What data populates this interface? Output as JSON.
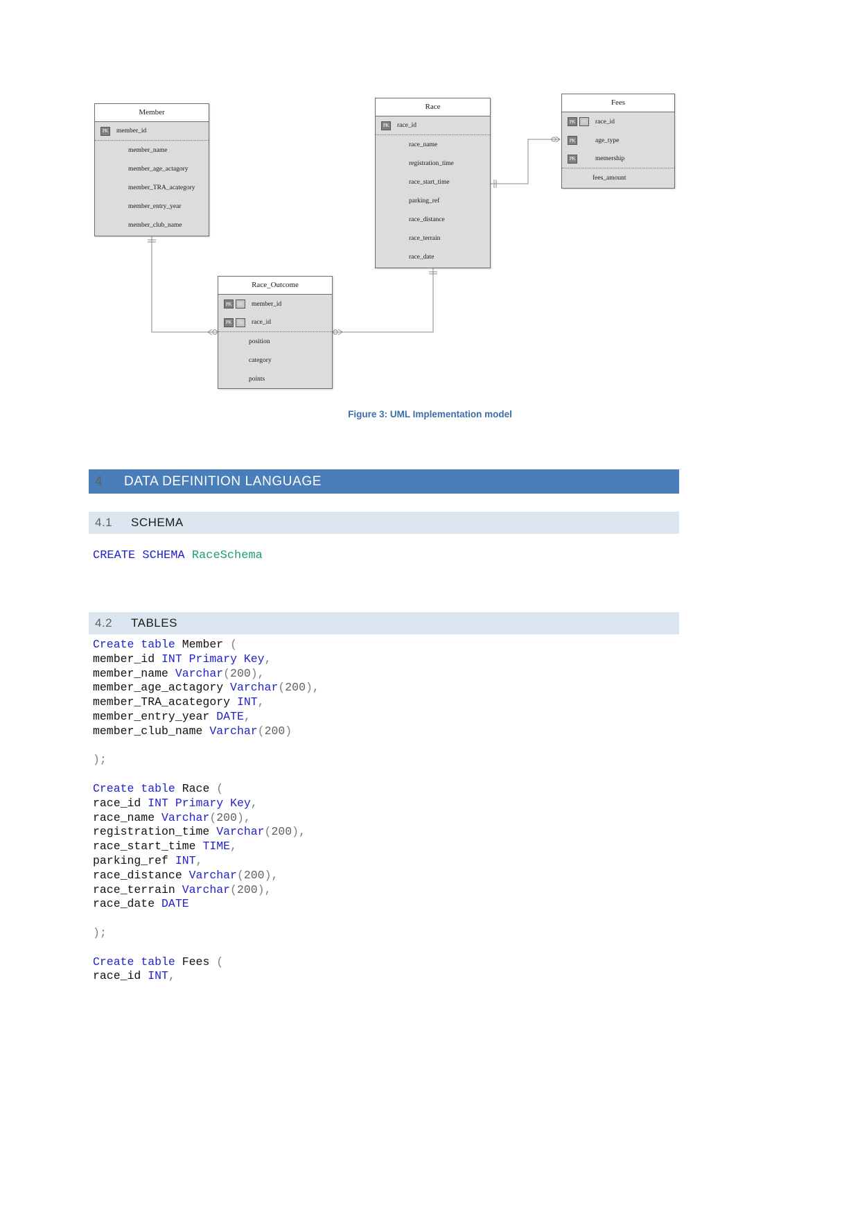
{
  "figure": {
    "caption": "Figure 3: UML Implementation model",
    "entities": [
      {
        "name": "Member",
        "attributes": [
          {
            "pk": "PK",
            "fk": "",
            "label": "member_id",
            "separator": true
          },
          {
            "pk": "",
            "fk": "",
            "label": "member_name",
            "separator": false
          },
          {
            "pk": "",
            "fk": "",
            "label": "member_age_actagory",
            "separator": false
          },
          {
            "pk": "",
            "fk": "",
            "label": "member_TRA_acategory",
            "separator": false
          },
          {
            "pk": "",
            "fk": "",
            "label": "member_entry_year",
            "separator": false
          },
          {
            "pk": "",
            "fk": "",
            "label": "member_club_name",
            "separator": false
          }
        ]
      },
      {
        "name": "Race",
        "attributes": [
          {
            "pk": "PK",
            "fk": "",
            "label": "race_id",
            "separator": true
          },
          {
            "pk": "",
            "fk": "",
            "label": "race_name",
            "separator": false
          },
          {
            "pk": "",
            "fk": "",
            "label": "registration_time",
            "separator": false
          },
          {
            "pk": "",
            "fk": "",
            "label": "race_start_time",
            "separator": false
          },
          {
            "pk": "",
            "fk": "",
            "label": "parking_ref",
            "separator": false
          },
          {
            "pk": "",
            "fk": "",
            "label": "race_distance",
            "separator": false
          },
          {
            "pk": "",
            "fk": "",
            "label": "race_terrain",
            "separator": false
          },
          {
            "pk": "",
            "fk": "",
            "label": "race_date",
            "separator": false
          }
        ]
      },
      {
        "name": "Fees",
        "attributes": [
          {
            "pk": "PK",
            "fk": "FK",
            "label": "race_id",
            "separator": false
          },
          {
            "pk": "PK",
            "fk": "",
            "label": "age_type",
            "separator": false
          },
          {
            "pk": "PK",
            "fk": "",
            "label": "memership",
            "separator": true
          },
          {
            "pk": "",
            "fk": "",
            "label": "fees_amount",
            "separator": false
          }
        ]
      },
      {
        "name": "Race_Outcome",
        "attributes": [
          {
            "pk": "PK",
            "fk": "FK",
            "label": "member_id",
            "separator": false
          },
          {
            "pk": "PK",
            "fk": "FK",
            "label": "race_id",
            "separator": true
          },
          {
            "pk": "",
            "fk": "",
            "label": "position",
            "separator": false
          },
          {
            "pk": "",
            "fk": "",
            "label": "category",
            "separator": false
          },
          {
            "pk": "",
            "fk": "",
            "label": "points",
            "separator": false
          }
        ]
      }
    ]
  },
  "headings": {
    "section4": {
      "number": "4",
      "title": "DATA DEFINITION LANGUAGE"
    },
    "section41": {
      "number": "4.1",
      "title": "SCHEMA"
    },
    "section42": {
      "number": "4.2",
      "title": "TABLES"
    }
  },
  "code": {
    "schema": "CREATE SCHEMA RaceSchema",
    "tables": "Create table Member (\nmember_id INT Primary Key,\nmember_name Varchar(200),\nmember_age_actagory Varchar(200),\nmember_TRA_acategory INT,\nmember_entry_year DATE,\nmember_club_name Varchar(200)\n\n);\n\nCreate table Race (\nrace_id INT Primary Key,\nrace_name Varchar(200),\nregistration_time Varchar(200),\nrace_start_time TIME,\nparking_ref INT,\nrace_distance Varchar(200),\nrace_terrain Varchar(200),\nrace_date DATE\n\n);\n\nCreate table Fees (\nrace_id INT,"
  },
  "colors": {
    "heading_bar": "#4a7ebb",
    "subheading_bar": "#dce6f1",
    "caption_text": "#3a6ea5",
    "keyword": "#2222cc",
    "schema_name": "#1f9e6e",
    "entity_fill": "#dcdcdc",
    "entity_border": "#6b6b6b"
  }
}
